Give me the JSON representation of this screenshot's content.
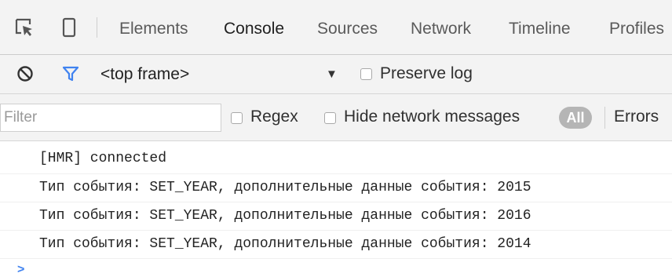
{
  "tabs": [
    {
      "label": "Elements",
      "active": false
    },
    {
      "label": "Console",
      "active": true
    },
    {
      "label": "Sources",
      "active": false
    },
    {
      "label": "Network",
      "active": false
    },
    {
      "label": "Timeline",
      "active": false
    },
    {
      "label": "Profiles",
      "active": false
    }
  ],
  "toolbar": {
    "clear_icon": "no-entry-icon",
    "filter_icon": "funnel-icon",
    "context": "<top frame>",
    "caret": "▼",
    "preserve_log": {
      "label": "Preserve log",
      "checked": false
    }
  },
  "filterbar": {
    "placeholder": "Filter",
    "regex": {
      "label": "Regex",
      "checked": false
    },
    "hide_network": {
      "label": "Hide network messages",
      "checked": false
    },
    "levels": [
      "All",
      "Errors"
    ],
    "active_level": "All"
  },
  "messages": [
    "[HMR] connected",
    "Тип события: SET_YEAR, дополнительные данные события: 2015",
    "Тип события: SET_YEAR, дополнительные данные события: 2016",
    "Тип события: SET_YEAR, дополнительные данные события: 2014"
  ],
  "prompt": ">",
  "colors": {
    "accent": "#3f82f0",
    "badge": "#b5b5b5"
  }
}
